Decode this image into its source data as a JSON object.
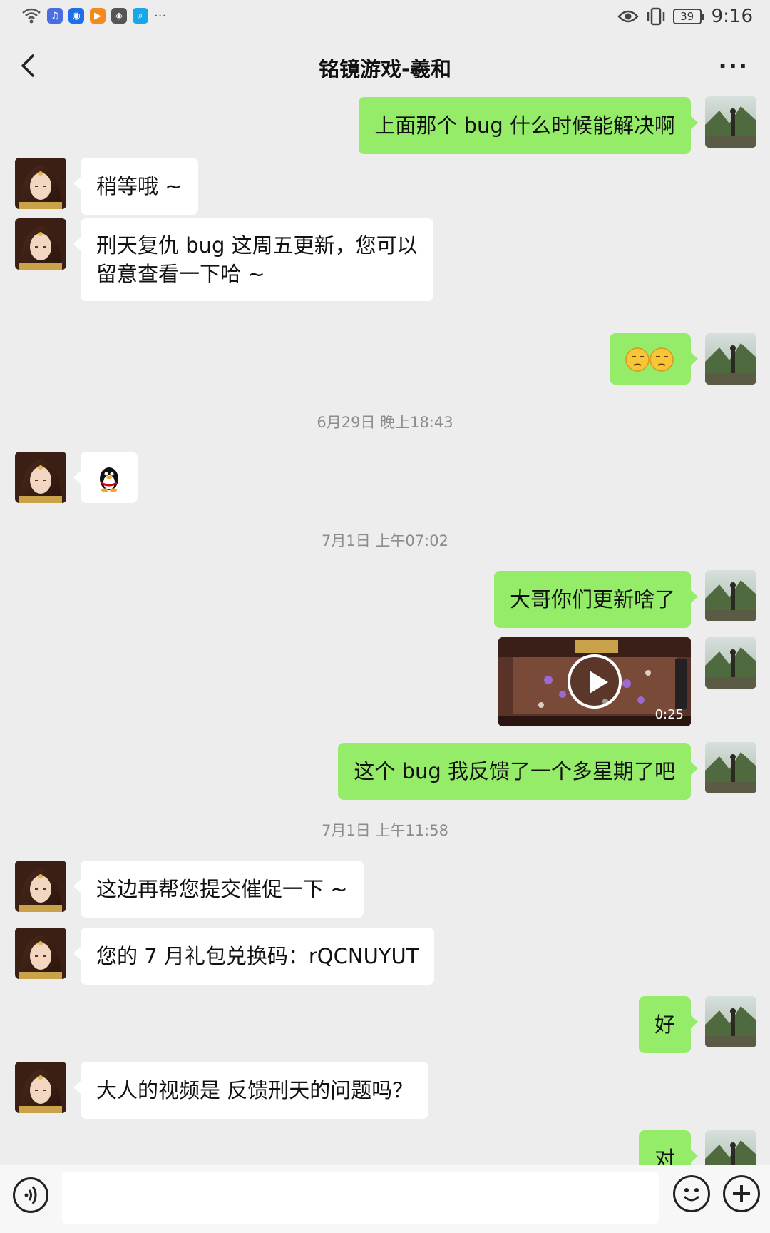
{
  "status_bar": {
    "time": "9:16",
    "battery": "39",
    "more": "···",
    "icons": [
      "wifi-icon",
      "music-app-icon",
      "bulb-app-icon",
      "video-app-icon",
      "camera-app-icon",
      "search-app-icon",
      "eye-icon",
      "vibrate-icon"
    ]
  },
  "header": {
    "title": "铭镜游戏-羲和",
    "back_icon": "chevron-left-icon",
    "more_label": "···"
  },
  "colors": {
    "outgoing_bubble": "#95ec69",
    "incoming_bubble": "#ffffff",
    "background": "#ededed"
  },
  "messages": [
    {
      "dir": "out",
      "text": "上面那个 bug 什么时候能解决啊"
    },
    {
      "dir": "in",
      "text": "稍等哦 ~"
    },
    {
      "dir": "in",
      "text": "刑天复仇 bug 这周五更新，您可以",
      "text2": "留意查看一下哈 ~"
    },
    {
      "dir": "out",
      "text": "🤔🤔",
      "type": "emoji"
    },
    {
      "dir": "in",
      "text": "",
      "type": "sticker",
      "sticker": "qq-penguin-sticker"
    },
    {
      "dir": "out",
      "text": "大哥你们更新啥了"
    },
    {
      "dir": "out",
      "type": "video",
      "duration": "0:25"
    },
    {
      "dir": "out",
      "text": "这个 bug 我反馈了一个多星期了吧"
    },
    {
      "dir": "in",
      "text": "这边再帮您提交催促一下 ~"
    },
    {
      "dir": "in",
      "text": "您的 7 月礼包兑换码：rQCNUYUT"
    },
    {
      "dir": "out",
      "text": "好"
    },
    {
      "dir": "in",
      "text": "大人的视频是 反馈刑天的问题吗？"
    },
    {
      "dir": "out",
      "text": "对"
    }
  ],
  "timestamps": [
    "6月29日 晚上18:43",
    "7月1日 上午07:02",
    "7月1日 上午11:58"
  ],
  "input_bar": {
    "voice_icon": "voice-icon",
    "emoji_icon": "emoji-icon",
    "plus_icon": "plus-icon"
  }
}
